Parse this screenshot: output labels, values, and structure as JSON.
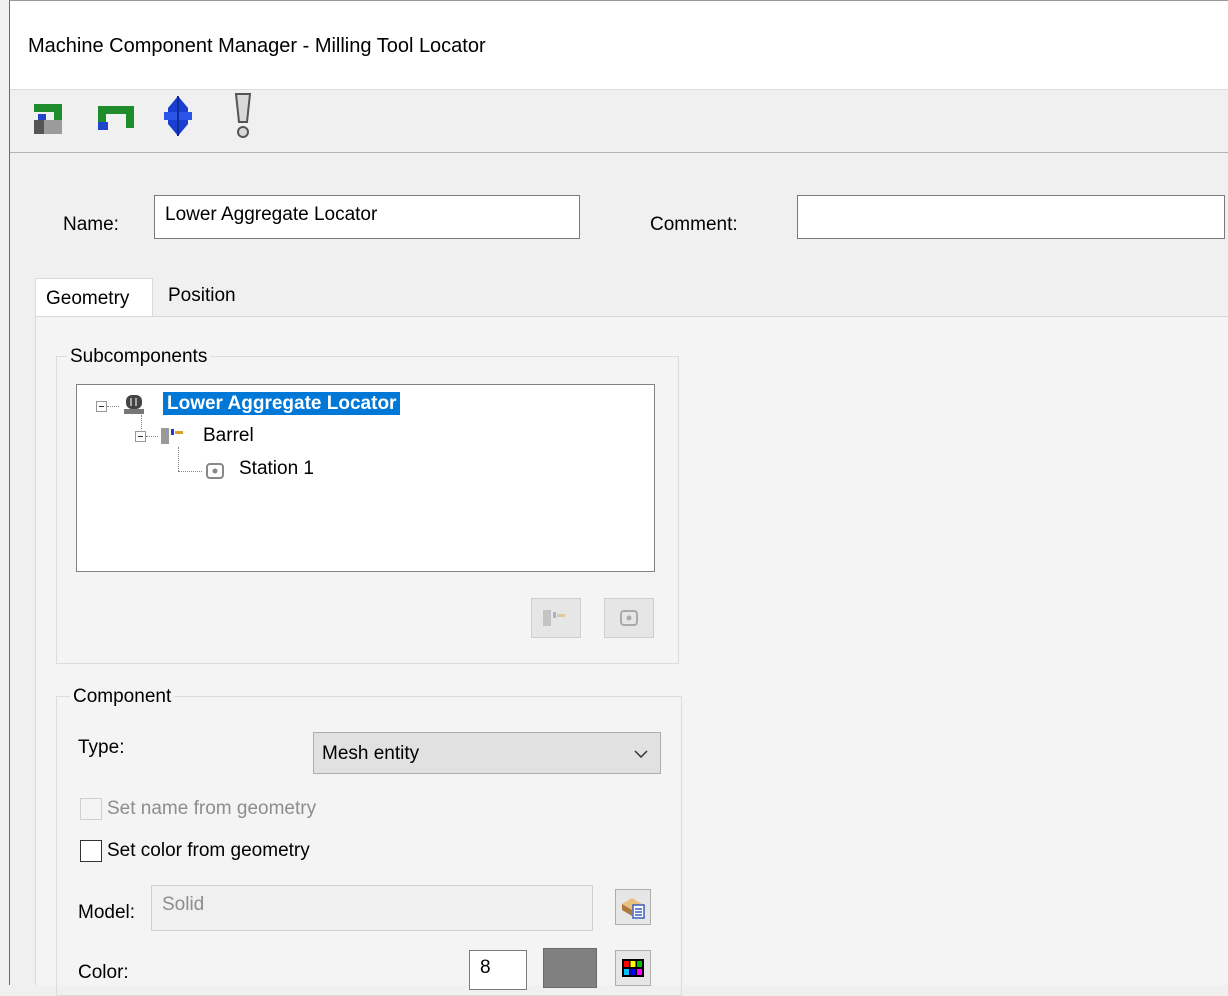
{
  "window": {
    "title": "Machine Component Manager - Milling Tool Locator"
  },
  "toolbar": {
    "buttons": [
      {
        "icon": "green-frame-icon"
      },
      {
        "icon": "green-bracket-icon"
      },
      {
        "icon": "blue-spindle-icon"
      },
      {
        "icon": "exclamation-icon"
      }
    ]
  },
  "form": {
    "name_label": "Name:",
    "name_value": "Lower Aggregate Locator",
    "comment_label": "Comment:",
    "comment_value": ""
  },
  "tabs": [
    {
      "label": "Geometry",
      "active": true
    },
    {
      "label": "Position",
      "active": false
    }
  ],
  "subcomponents": {
    "title": "Subcomponents",
    "tree": {
      "root": "Lower Aggregate Locator",
      "child": "Barrel",
      "grandchild": "Station 1"
    }
  },
  "component": {
    "title": "Component",
    "type_label": "Type:",
    "type_value": "Mesh entity",
    "set_name_label": "Set name from geometry",
    "set_color_label": "Set color from geometry",
    "model_label": "Model:",
    "model_value": "Solid",
    "color_label": "Color:",
    "color_value": "8",
    "swatch_color": "#808080"
  },
  "colors": {
    "accent": "#0078d7"
  }
}
